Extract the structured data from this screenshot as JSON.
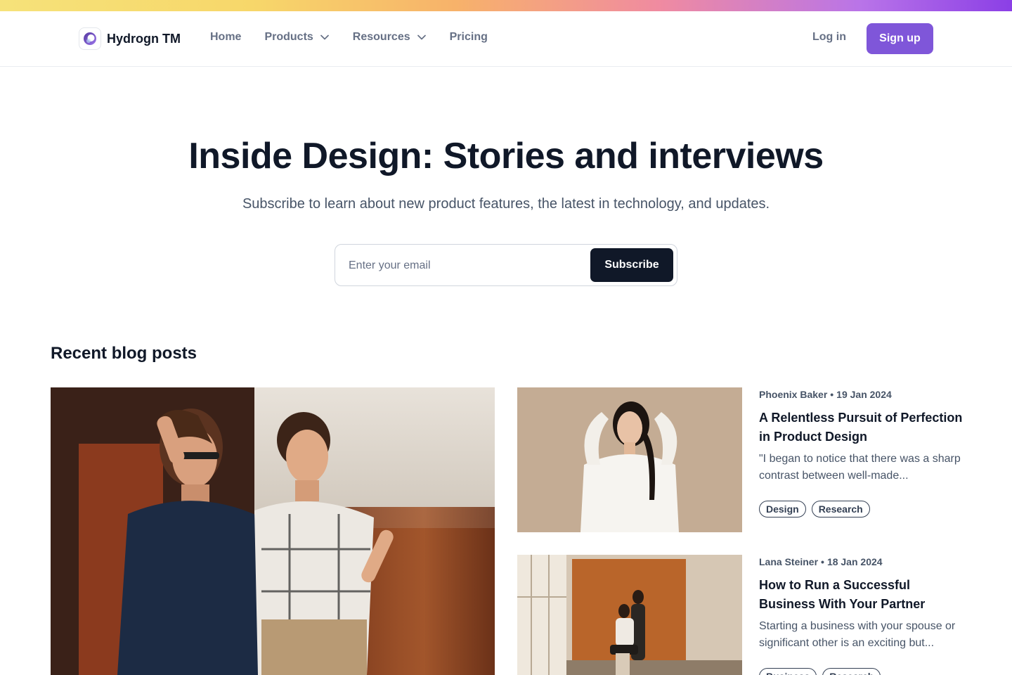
{
  "brand": {
    "name": "Hydrogn TM",
    "accent": "#7f56d9",
    "dark": "#101828"
  },
  "nav": {
    "links": [
      {
        "label": "Home",
        "dropdown": false
      },
      {
        "label": "Products",
        "dropdown": true
      },
      {
        "label": "Resources",
        "dropdown": true
      },
      {
        "label": "Pricing",
        "dropdown": false
      }
    ],
    "login": "Log in",
    "signup": "Sign up"
  },
  "hero": {
    "title": "Inside Design: Stories and interviews",
    "subtitle": "Subscribe to learn about new product features, the latest in technology, and updates.",
    "email_placeholder": "Enter your email",
    "subscribe_label": "Subscribe"
  },
  "blog": {
    "section_title": "Recent blog posts",
    "featured_image": "photo of two women smiling",
    "posts": [
      {
        "author": "Phoenix Baker",
        "date": "19 Jan 2024",
        "title": "A Relentless Pursuit of Perfection in Product Design",
        "excerpt": "\"I began to notice that there was a sharp contrast between well-made...",
        "tags": [
          "Design",
          "Research"
        ],
        "image": "woman in white blouse"
      },
      {
        "author": "Lana Steiner",
        "date": "18 Jan 2024",
        "title": "How to Run a Successful Business With Your Partner",
        "excerpt": "Starting a business with your spouse or significant other is an exciting but...",
        "tags": [
          "Business",
          "Research"
        ],
        "image": "couple posing in studio"
      }
    ]
  }
}
